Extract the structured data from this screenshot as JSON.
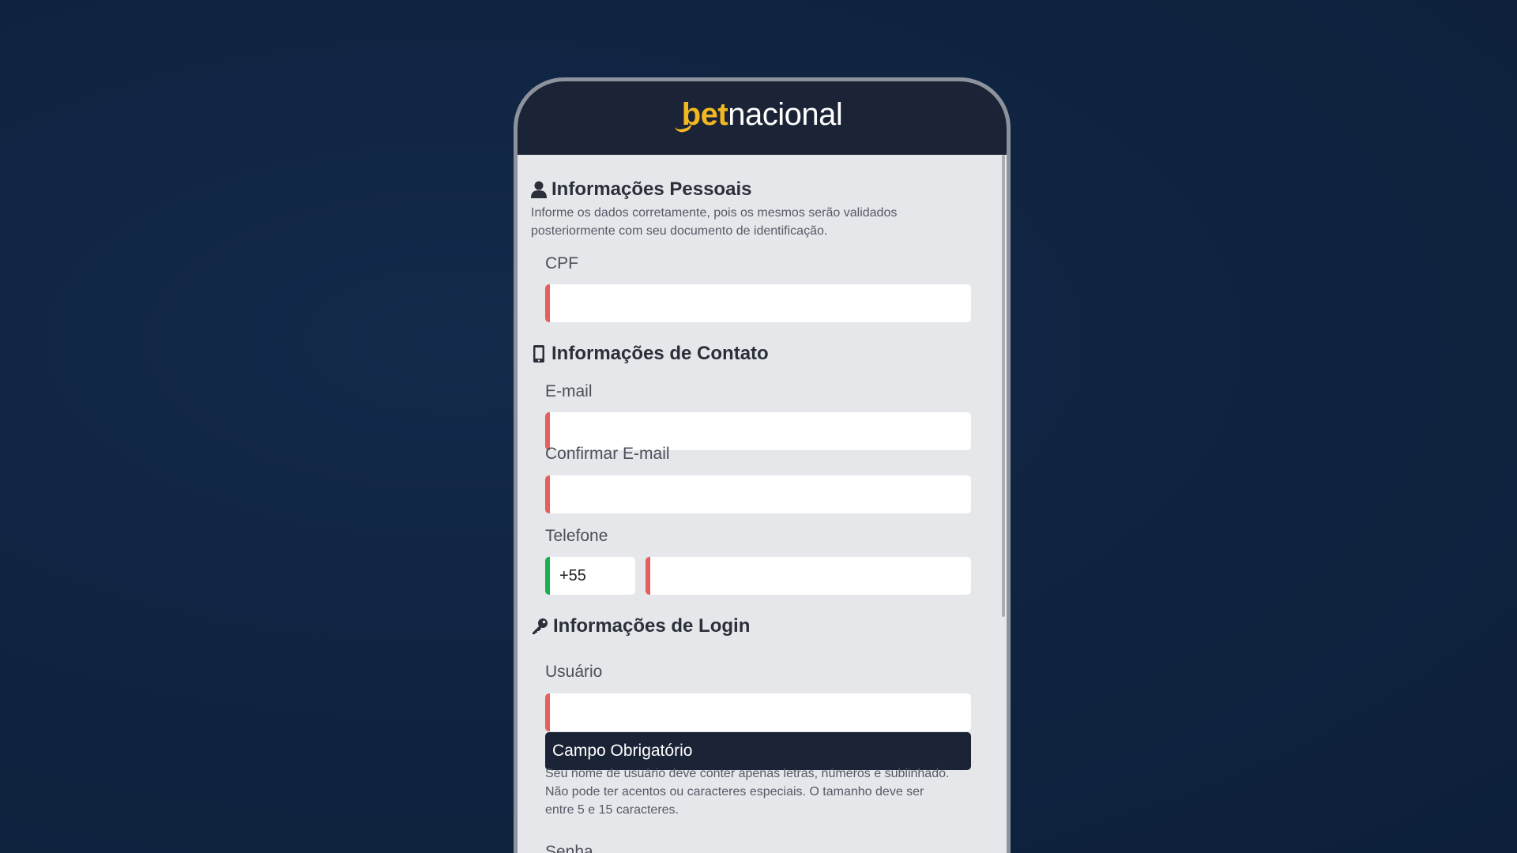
{
  "brand": {
    "part1": "bet",
    "part2": "nacional",
    "accent": "#f2b721",
    "header_bg": "#1b2436"
  },
  "sections": {
    "personal": {
      "title": "Informações Pessoais",
      "icon": "user-icon",
      "description_line1": "Informe os dados corretamente, pois os mesmos serão validados",
      "description_line2": "posteriormente com seu documento de identificação.",
      "fields": {
        "cpf": {
          "label": "CPF",
          "value": ""
        }
      }
    },
    "contact": {
      "title": "Informações de Contato",
      "icon": "mobile-phone-icon",
      "fields": {
        "email": {
          "label": "E-mail",
          "value": ""
        },
        "confirm_email": {
          "label": "Confirmar E-mail",
          "value": ""
        },
        "phone": {
          "label": "Telefone",
          "country_code": "+55",
          "value": ""
        }
      }
    },
    "login": {
      "title": "Informações de Login",
      "icon": "key-icon",
      "fields": {
        "username": {
          "label": "Usuário",
          "value": "",
          "error": "Campo Obrigatório",
          "hint_line1": "Seu nome de usuário deve conter apenas letras, números e sublinhado.",
          "hint_line2": "Não pode ter acentos ou caracteres especiais. O tamanho deve ser",
          "hint_line3": "entre 5 e 15 caracteres."
        },
        "password": {
          "label": "Senha"
        }
      }
    }
  },
  "colors": {
    "invalid": "#e5605a",
    "valid": "#19b34d",
    "page_bg": "#0f2340"
  }
}
